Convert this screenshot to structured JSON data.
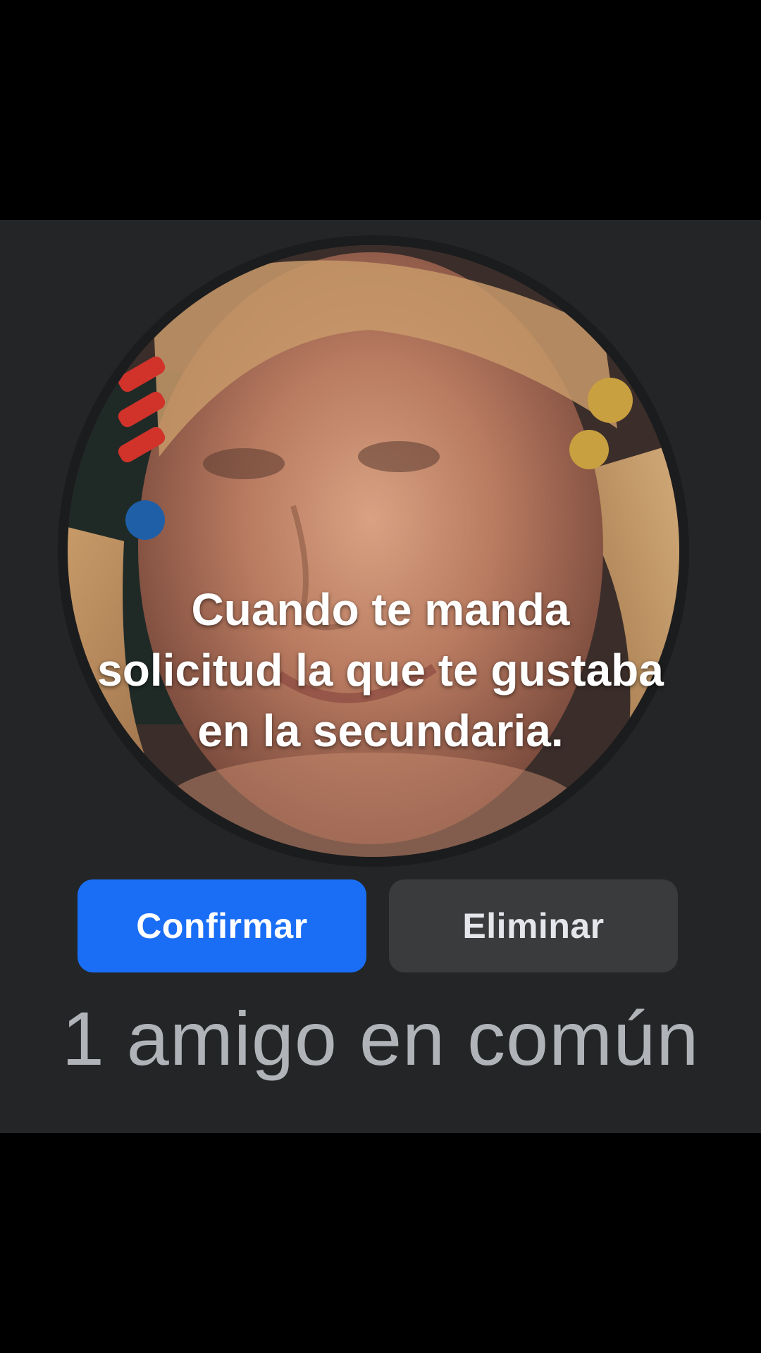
{
  "profile": {
    "caption_lines": [
      "Cuando te manda",
      "solicitud la que te gustaba",
      "en la secundaria."
    ]
  },
  "actions": {
    "confirm_label": "Confirmar",
    "delete_label": "Eliminar"
  },
  "mutual_friends": {
    "text": "1 amigo en común"
  },
  "colors": {
    "background": "#242526",
    "letterbox": "#000000",
    "confirm_button": "#1a6ef5",
    "delete_button": "#3a3b3c",
    "muted_text": "#b0b3b8"
  }
}
